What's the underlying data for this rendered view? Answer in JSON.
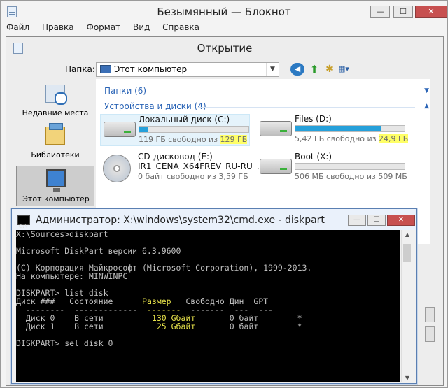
{
  "notepad": {
    "title": "Безымянный — Блокнот",
    "menu": [
      "Файл",
      "Правка",
      "Формат",
      "Вид",
      "Справка"
    ],
    "icon": "notepad-icon"
  },
  "dialog": {
    "title": "Открытие",
    "folder_label": "Папка:",
    "folder_value": "Этот компьютер",
    "nav": [
      {
        "label": "Недавние места",
        "icon": "recent-places-icon"
      },
      {
        "label": "Библиотеки",
        "icon": "libraries-icon"
      },
      {
        "label": "Этот компьютер",
        "icon": "this-pc-icon"
      }
    ],
    "groups": {
      "folders": "Папки (6)",
      "drives": "Устройства и диски (4)"
    },
    "drives": [
      {
        "name": "Локальный диск (C:)",
        "free": "119 ГБ свободно из ",
        "total": "129 ГБ",
        "used_fraction": 0.08
      },
      {
        "name": "Files (D:)",
        "free": "5,42 ГБ свободно из ",
        "total": "24,9 ГБ",
        "used_fraction": 0.78
      },
      {
        "name": "CD-дисковод (E:)",
        "label": "IR1_CENA_X64FREV_RU-RU_...",
        "info": "0 байт свободно из 3,59 ГБ"
      },
      {
        "name": "Boot (X:)",
        "info": "506 МБ свободно из 509 МБ",
        "used_fraction": 0.0
      }
    ]
  },
  "cmd": {
    "title": "Администратор: X:\\windows\\system32\\cmd.exe - diskpart",
    "lines": [
      "X:\\Sources>diskpart",
      "",
      "Microsoft DiskPart версии 6.3.9600",
      "",
      "(C) Корпорация Майкрософт (Microsoft Corporation), 1999-2013.",
      "На компьютере: MINWINPC",
      "",
      "DISKPART> list disk",
      ""
    ],
    "table": {
      "headers": [
        "Диск ###",
        "Состояние",
        "Размер",
        "Свободно",
        "Дин",
        "GPT"
      ],
      "rows": [
        {
          "disk": "Диск 0",
          "state": "В сети",
          "size": "130 Gбайт",
          "free": "0 байт",
          "dyn": "",
          "gpt": "*"
        },
        {
          "disk": "Диск 1",
          "state": "В сети",
          "size": "25 Gбайт",
          "free": "0 байт",
          "dyn": "",
          "gpt": "*"
        }
      ]
    },
    "last_command": "DISKPART> sel disk 0"
  },
  "colors": {
    "accent": "#26a0da",
    "highlight": "#ffff66",
    "console_yellow": "#e7e24a"
  }
}
